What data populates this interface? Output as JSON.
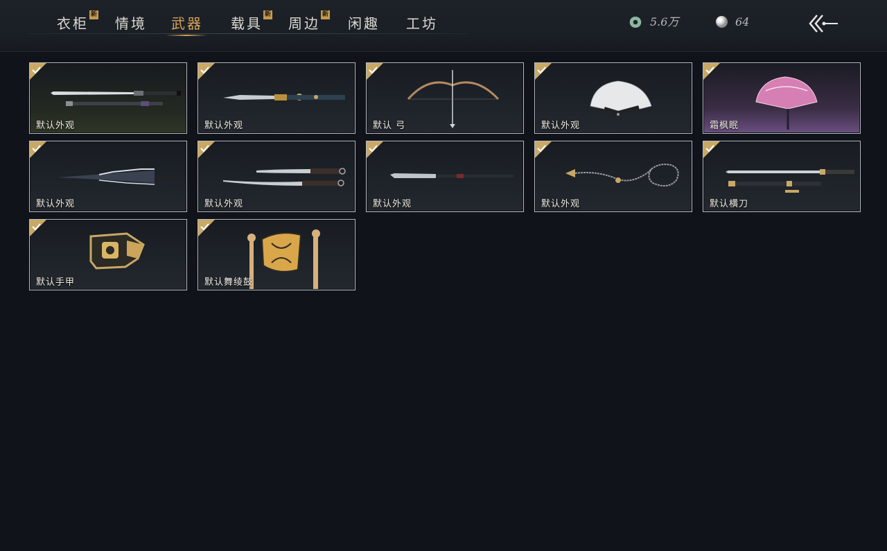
{
  "tabs": [
    {
      "label": "衣柜",
      "badge": "新"
    },
    {
      "label": "情境",
      "badge": ""
    },
    {
      "label": "武器",
      "badge": ""
    },
    {
      "label": "载具",
      "badge": "新"
    },
    {
      "label": "周边",
      "badge": "新"
    },
    {
      "label": "闲趣",
      "badge": ""
    },
    {
      "label": "工坊",
      "badge": ""
    }
  ],
  "active_tab": "武器",
  "currency": {
    "coins": "5.6万",
    "pearls": "64"
  },
  "items": [
    {
      "label": "默认外观",
      "icon": "sword-and-scabbard",
      "equipped": true
    },
    {
      "label": "默认外观",
      "icon": "ornate-blade",
      "equipped": true
    },
    {
      "label": "默认 弓",
      "icon": "bow",
      "equipped": true
    },
    {
      "label": "默认外观",
      "icon": "white-fan",
      "equipped": true
    },
    {
      "label": "霜枫眠",
      "icon": "pink-fan",
      "equipped": true
    },
    {
      "label": "默认外观",
      "icon": "umbrella",
      "equipped": true
    },
    {
      "label": "默认外观",
      "icon": "twin-blades",
      "equipped": true
    },
    {
      "label": "默认外观",
      "icon": "long-glaive",
      "equipped": true
    },
    {
      "label": "默认外观",
      "icon": "rope-dart",
      "equipped": true
    },
    {
      "label": "默认横刀",
      "icon": "hengdao",
      "equipped": true
    },
    {
      "label": "默认手甲",
      "icon": "gauntlet",
      "equipped": true
    },
    {
      "label": "默认舞绫鼓",
      "icon": "drum-and-sticks",
      "equipped": true
    }
  ],
  "colors": {
    "accent": "#d9a45a",
    "badge": "#c59a4e",
    "background": "#10141a"
  }
}
